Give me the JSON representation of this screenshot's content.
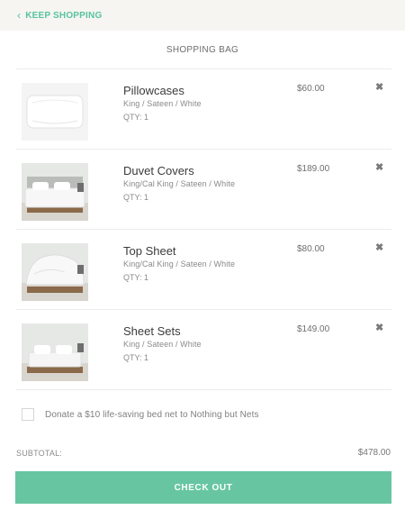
{
  "header": {
    "keep_shopping": "KEEP SHOPPING",
    "back_icon": "chevron-left-icon"
  },
  "page_title": "SHOPPING BAG",
  "items": [
    {
      "name": "Pillowcases",
      "options": "King / Sateen / White",
      "qty": "QTY: 1",
      "price": "$60.00",
      "image": "pillowcase-photo",
      "remove_icon": "close-icon"
    },
    {
      "name": "Duvet Covers",
      "options": "King/Cal King / Sateen / White",
      "qty": "QTY: 1",
      "price": "$189.00",
      "image": "duvet-photo",
      "remove_icon": "close-icon"
    },
    {
      "name": "Top Sheet",
      "options": "King/Cal King / Sateen / White",
      "qty": "QTY: 1",
      "price": "$80.00",
      "image": "top-sheet-photo",
      "remove_icon": "close-icon"
    },
    {
      "name": "Sheet Sets",
      "options": "King / Sateen / White",
      "qty": "QTY: 1",
      "price": "$149.00",
      "image": "sheet-set-photo",
      "remove_icon": "close-icon"
    }
  ],
  "donation": {
    "label": "Donate a $10 life-saving bed net to Nothing but Nets",
    "checked": false
  },
  "subtotal": {
    "label": "SUBTOTAL:",
    "value": "$478.00"
  },
  "checkout_label": "CHECK OUT",
  "colors": {
    "accent": "#67c6a1",
    "link": "#58c3a0",
    "topbar": "#f6f5f2"
  }
}
